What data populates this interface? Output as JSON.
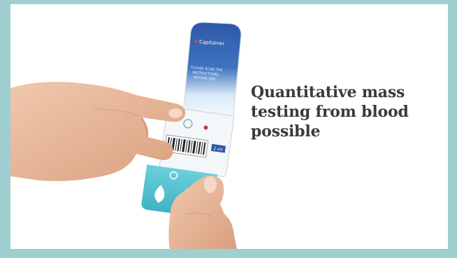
{
  "headline": {
    "lines": [
      "Quantitative mass",
      "testing from blood",
      "possible"
    ]
  },
  "device": {
    "brand_label": "Capitainer",
    "instruction_text": [
      "PLEASE SCAN THE",
      "INSTRUCTIONS",
      "BEFORE USE"
    ],
    "tag_label": "2 ml"
  },
  "colors": {
    "frame": "#9fcfd0",
    "panel": "#ffffff",
    "card_blue": "#2f57a6",
    "card_teal": "#4fc0cf",
    "headline": "#3a3a3a",
    "skin": "#e9b89a"
  }
}
